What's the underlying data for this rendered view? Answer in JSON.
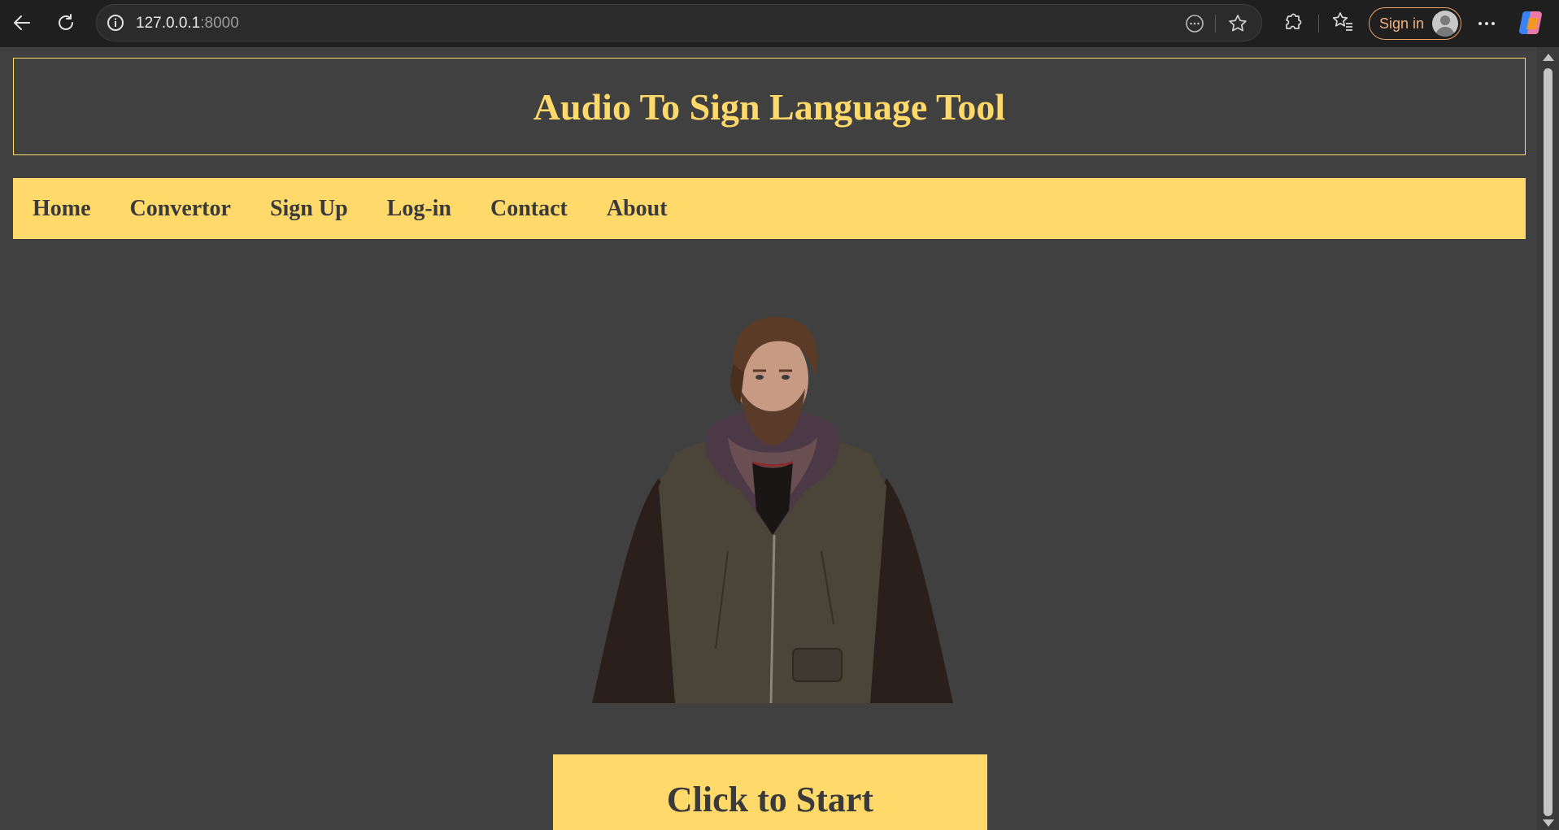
{
  "browser": {
    "url_host": "127.0.0.1",
    "url_port": ":8000",
    "signin_label": "Sign in"
  },
  "page": {
    "title": "Audio To Sign Language Tool",
    "nav": [
      {
        "label": "Home"
      },
      {
        "label": "Convertor"
      },
      {
        "label": "Sign Up"
      },
      {
        "label": "Log-in"
      },
      {
        "label": "Contact"
      },
      {
        "label": "About"
      }
    ],
    "start_button": "Click to Start"
  },
  "colors": {
    "accent": "#ffd96a",
    "background": "#404040",
    "text_dark": "#3a3a3a"
  },
  "icons": [
    "back-icon",
    "reload-icon",
    "info-icon",
    "reader-mode-icon",
    "star-icon",
    "extensions-icon",
    "favorites-icon",
    "profile-icon",
    "more-icon",
    "copilot-icon"
  ]
}
